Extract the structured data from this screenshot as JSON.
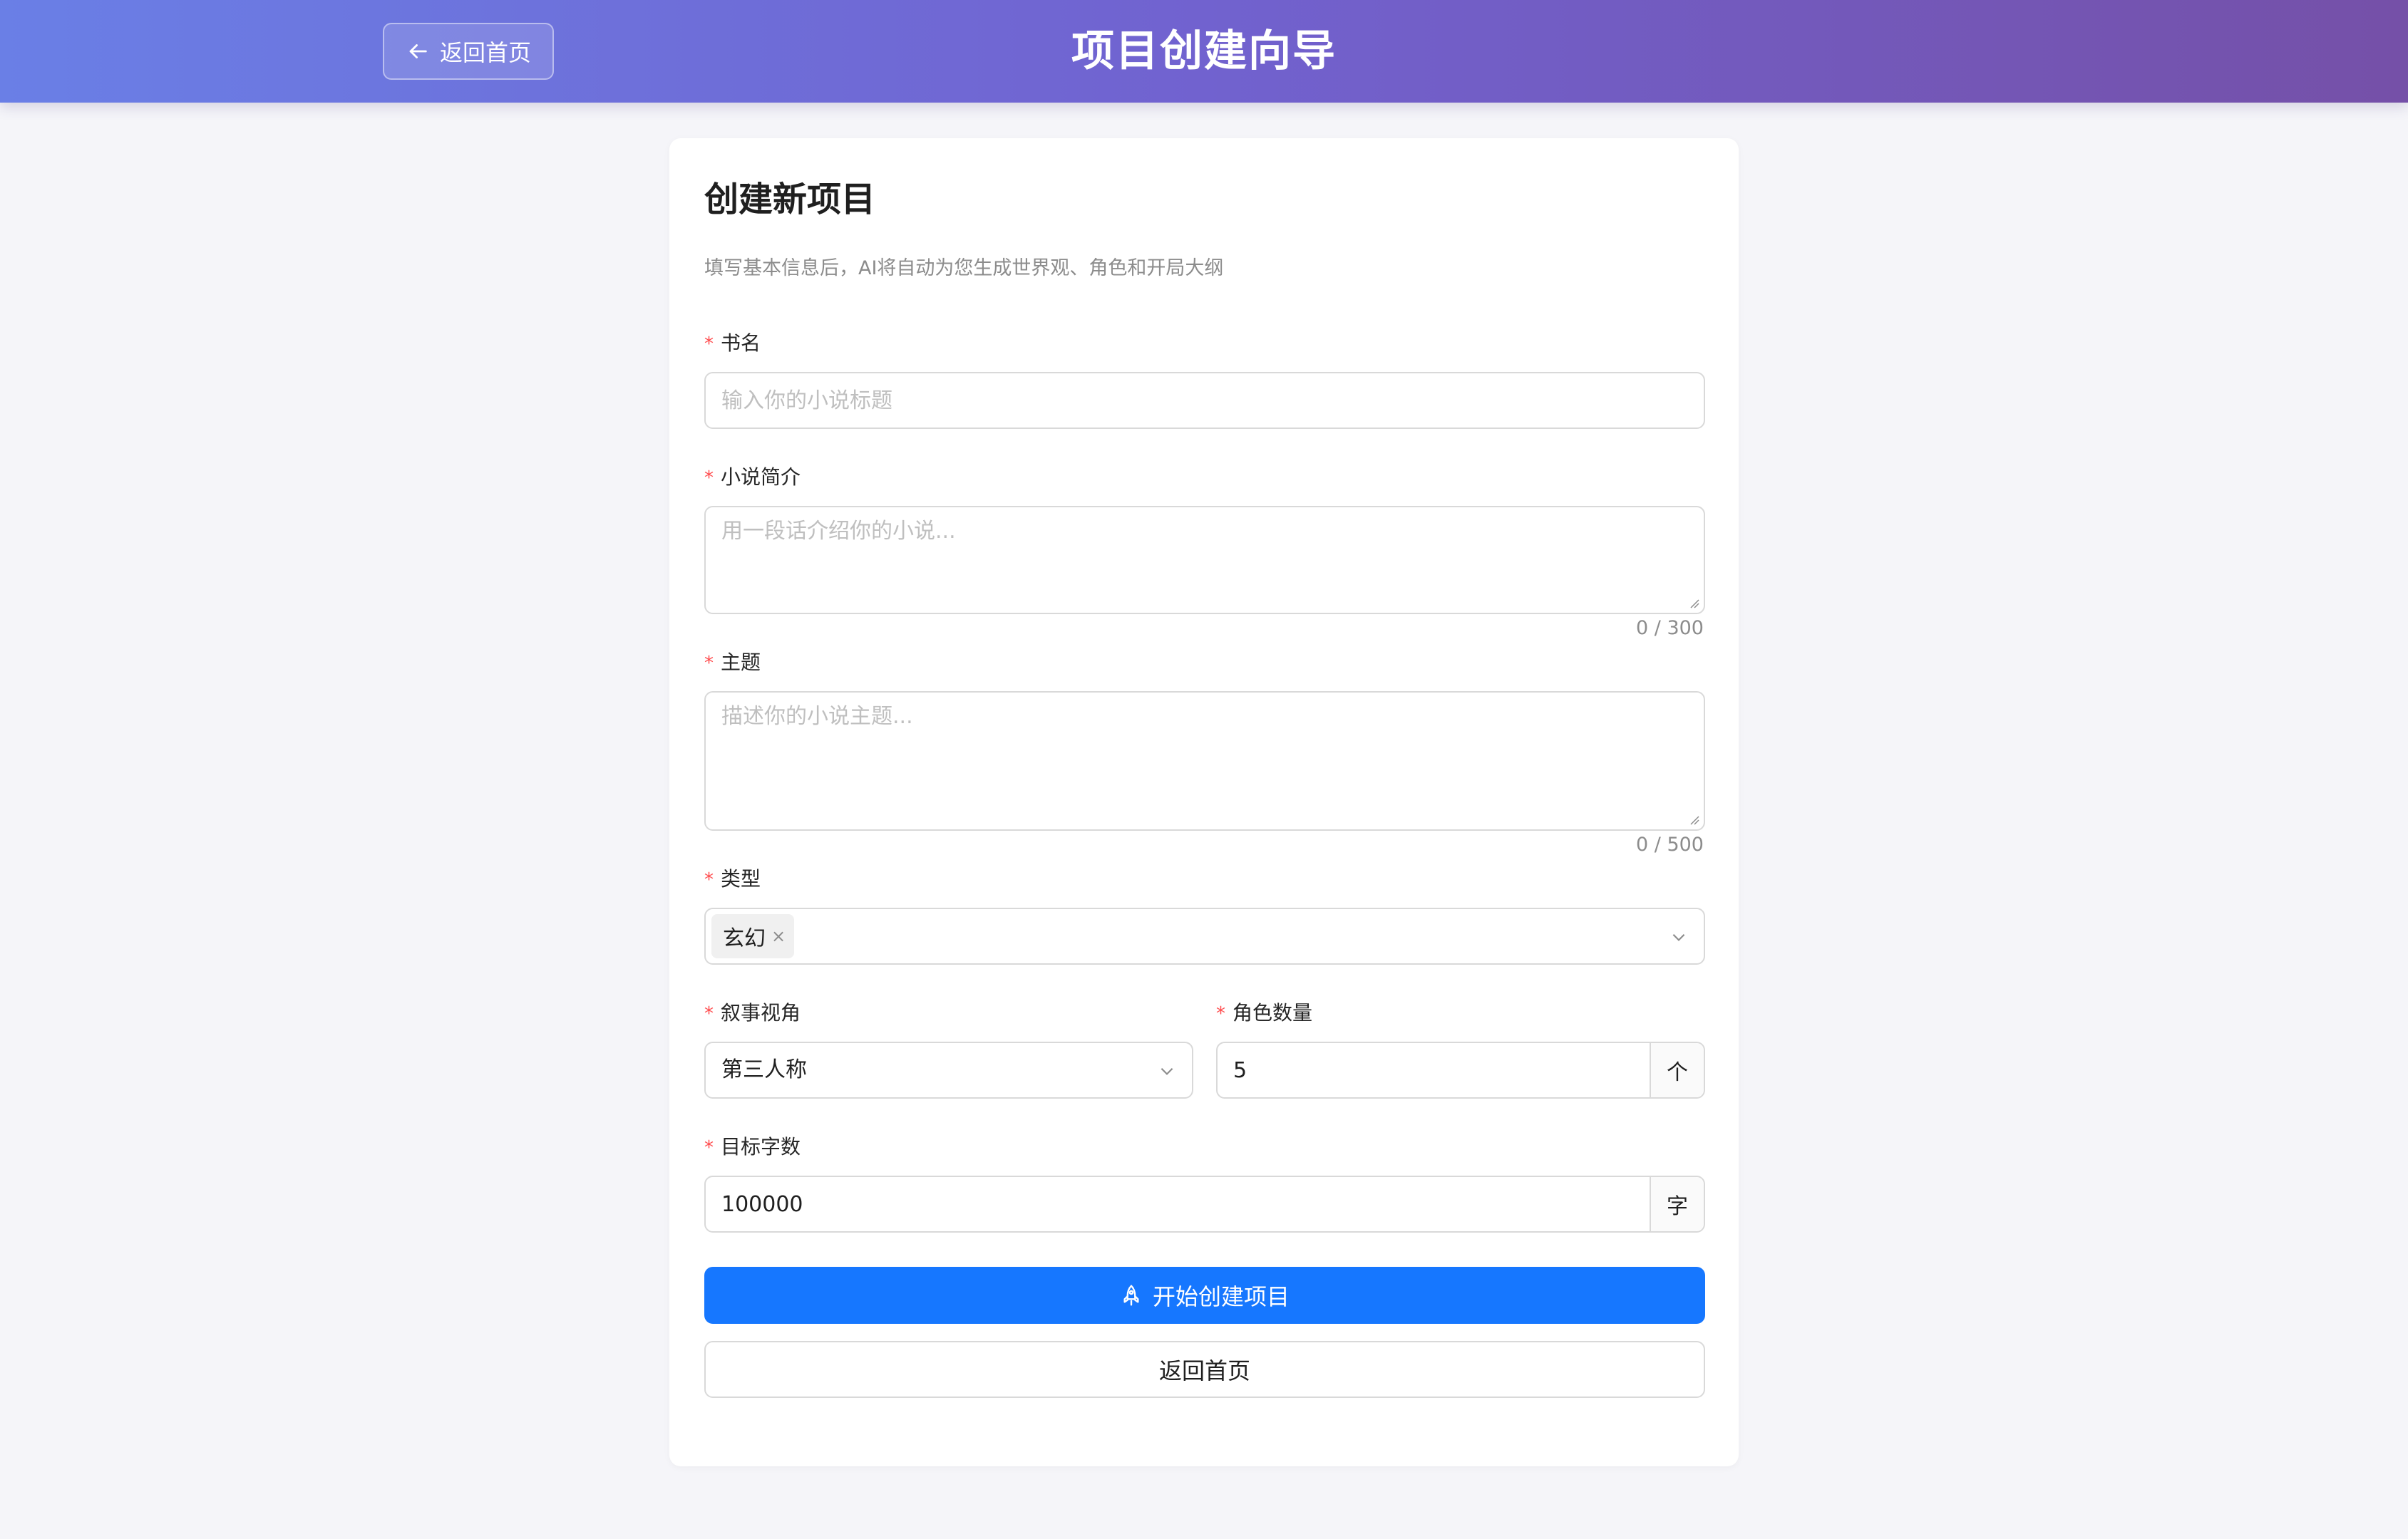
{
  "header": {
    "back_label": "返回首页",
    "title": "项目创建向导"
  },
  "card": {
    "title": "创建新项目",
    "description": "填写基本信息后，AI将自动为您生成世界观、角色和开局大纲"
  },
  "form": {
    "required_mark": "*",
    "book_name": {
      "label": "书名",
      "placeholder": "输入你的小说标题",
      "value": ""
    },
    "synopsis": {
      "label": "小说简介",
      "placeholder": "用一段话介绍你的小说...",
      "count": "0 / 300"
    },
    "theme": {
      "label": "主题",
      "placeholder": "描述你的小说主题...",
      "count": "0 / 500"
    },
    "genre": {
      "label": "类型",
      "tags": [
        "玄幻"
      ],
      "tag_remove": "×"
    },
    "perspective": {
      "label": "叙事视角",
      "value": "第三人称"
    },
    "character_count": {
      "label": "角色数量",
      "value": "5",
      "unit": "个"
    },
    "target_words": {
      "label": "目标字数",
      "value": "100000",
      "unit": "字"
    }
  },
  "actions": {
    "submit_label": "开始创建项目",
    "home_label": "返回首页"
  },
  "icons": {
    "back": "arrow-left-icon",
    "submit": "rocket-icon",
    "select": "chevron-down-icon"
  },
  "colors": {
    "primary": "#1677ff",
    "required": "#ff4d4f",
    "header_gradient_start": "#6a7fe6",
    "header_gradient_end": "#7550a8"
  }
}
